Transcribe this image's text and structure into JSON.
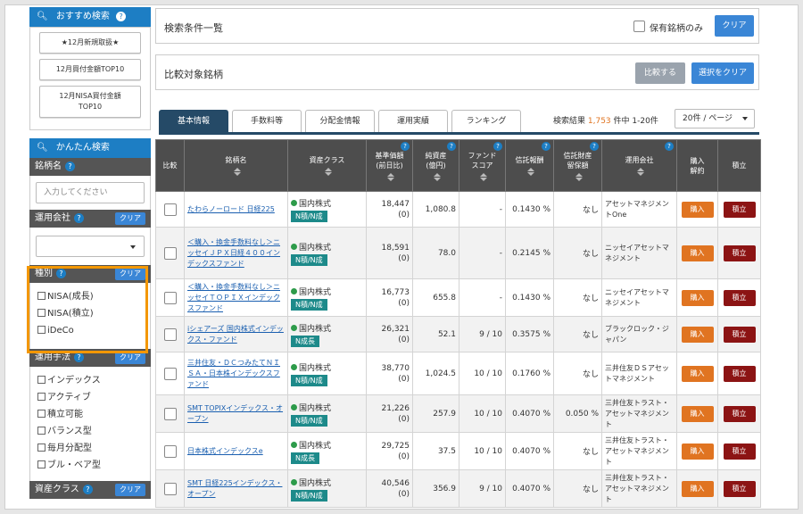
{
  "recommended": {
    "title": "おすすめ検索",
    "buttons": [
      "★12月新規取扱★",
      "12月買付金額TOP10",
      "12月NISA買付金額\nTOP10"
    ]
  },
  "easy_search": {
    "title": "かんたん検索"
  },
  "fund_name": {
    "label": "銘柄名",
    "placeholder": "入力してください"
  },
  "company": {
    "label": "運用会社",
    "clear": "クリア"
  },
  "kind": {
    "label": "種別",
    "clear": "クリア",
    "options": [
      "NISA(成長)",
      "NISA(積立)",
      "iDeCo"
    ]
  },
  "method": {
    "label": "運用手法",
    "clear": "クリア",
    "options": [
      "インデックス",
      "アクティブ",
      "積立可能",
      "バランス型",
      "毎月分配型",
      "ブル・ベア型"
    ]
  },
  "asset_class": {
    "label": "資産クラス",
    "clear": "クリア"
  },
  "search_conditions": {
    "title": "検索条件一覧",
    "held_only": "保有銘柄のみ",
    "clear": "クリア"
  },
  "compare": {
    "title": "比較対象銘柄",
    "compare_btn": "比較する",
    "clear_btn": "選択をクリア"
  },
  "tabs": [
    "基本情報",
    "手数料等",
    "分配金情報",
    "運用実績",
    "ランキング"
  ],
  "results": {
    "prefix": "検索結果",
    "count": "1,753",
    "suffix": "件中 1-20件",
    "per_page": "20件 / ページ"
  },
  "table": {
    "headers": [
      "比較",
      "銘柄名",
      "資産クラス",
      "基準価額\n(前日比)",
      "純資産\n(億円)",
      "ファンド\nスコア",
      "信託報酬",
      "信託財産\n留保額",
      "運用会社",
      "購入\n解約",
      "積立"
    ],
    "buy_label": "購入",
    "accum_label": "積立",
    "rows": [
      {
        "name": "たわらノーロード 日経225",
        "asset": "国内株式",
        "badge": "N積/N成",
        "nav": "18,447",
        "chg": "(0)",
        "aum": "1,080.8",
        "score": "-",
        "fee": "0.1430 %",
        "reserve": "なし",
        "company": "アセットマネジメントOne"
      },
      {
        "name": "＜購入・換金手数料なし＞ニッセイＪＰＸ日経４００インデックスファンド",
        "asset": "国内株式",
        "badge": "N積/N成",
        "nav": "18,591",
        "chg": "(0)",
        "aum": "78.0",
        "score": "-",
        "fee": "0.2145 %",
        "reserve": "なし",
        "company": "ニッセイアセットマネジメント"
      },
      {
        "name": "＜購入・換金手数料なし＞ニッセイＴＯＰＩＸインデックスファンド",
        "asset": "国内株式",
        "badge": "N積/N成",
        "nav": "16,773",
        "chg": "(0)",
        "aum": "655.8",
        "score": "-",
        "fee": "0.1430 %",
        "reserve": "なし",
        "company": "ニッセイアセットマネジメント"
      },
      {
        "name": "iシェアーズ 国内株式インデックス・ファンド",
        "asset": "国内株式",
        "badge": "N成長",
        "nav": "26,321",
        "chg": "(0)",
        "aum": "52.1",
        "score": "9 / 10",
        "fee": "0.3575 %",
        "reserve": "なし",
        "company": "ブラックロック・ジャパン"
      },
      {
        "name": "三井住友・ＤＣつみたてＮＩＳＡ・日本株インデックスファンド",
        "asset": "国内株式",
        "badge": "N積/N成",
        "nav": "38,770",
        "chg": "(0)",
        "aum": "1,024.5",
        "score": "10 / 10",
        "fee": "0.1760 %",
        "reserve": "なし",
        "company": "三井住友ＤＳアセットマネジメント"
      },
      {
        "name": "SMT TOPIXインデックス・オープン",
        "asset": "国内株式",
        "badge": "N積/N成",
        "nav": "21,226",
        "chg": "(0)",
        "aum": "257.9",
        "score": "10 / 10",
        "fee": "0.4070 %",
        "reserve": "0.050 %",
        "company": "三井住友トラスト・アセットマネジメント"
      },
      {
        "name": "日本株式インデックスe",
        "asset": "国内株式",
        "badge": "N成長",
        "nav": "29,725",
        "chg": "(0)",
        "aum": "37.5",
        "score": "10 / 10",
        "fee": "0.4070 %",
        "reserve": "なし",
        "company": "三井住友トラスト・アセットマネジメント"
      },
      {
        "name": "SMT 日経225インデックス・オープン",
        "asset": "国内株式",
        "badge": "N積/N成",
        "nav": "40,546",
        "chg": "(0)",
        "aum": "356.9",
        "score": "9 / 10",
        "fee": "0.4070 %",
        "reserve": "なし",
        "company": "三井住友トラスト・アセットマネジメント"
      }
    ]
  }
}
